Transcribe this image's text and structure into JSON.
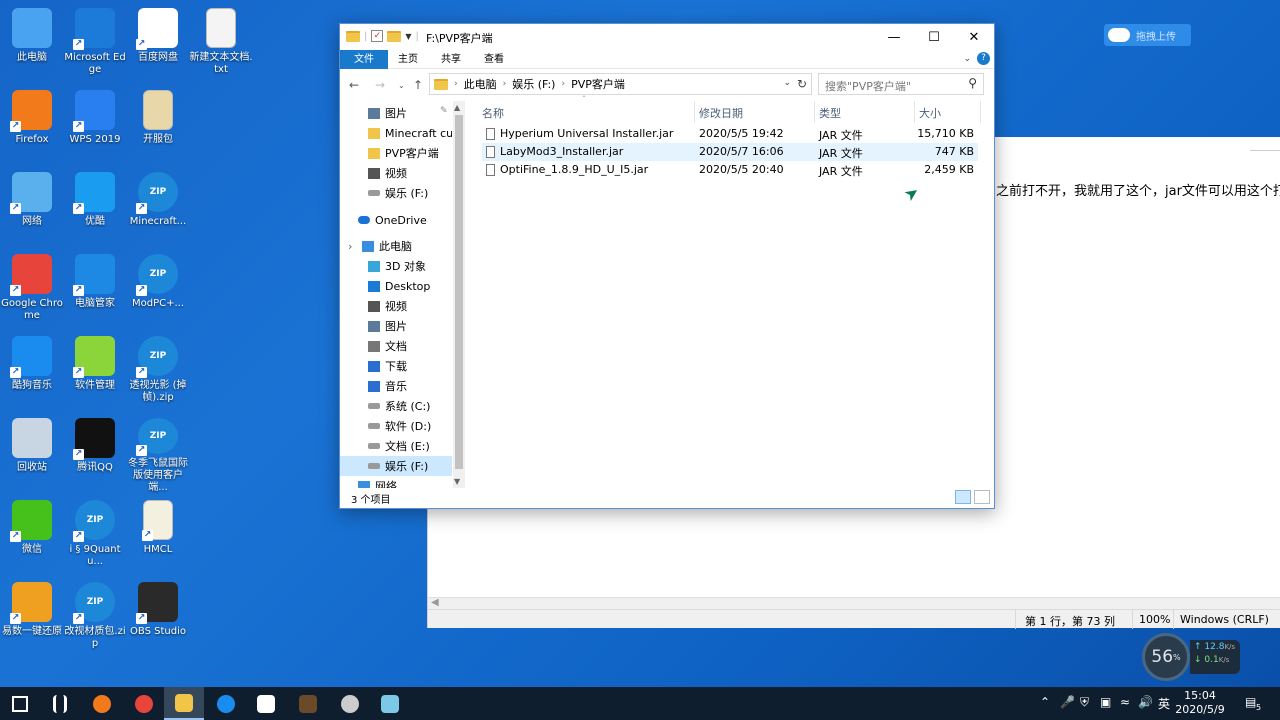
{
  "desktop": {
    "icons": [
      {
        "label": "此电脑",
        "icon": "computer-icon",
        "color": "#4aa3f0"
      },
      {
        "label": "Microsoft Edge",
        "icon": "edge-icon",
        "color": "#1c7ad8"
      },
      {
        "label": "百度网盘",
        "icon": "baidu-netdisk-icon",
        "color": "#ffffff"
      },
      {
        "label": "新建文本文档.txt",
        "icon": "text-file-icon",
        "color": "#f4f4f4"
      },
      {
        "label": "Firefox",
        "icon": "firefox-icon",
        "color": "#f27a1a"
      },
      {
        "label": "WPS 2019",
        "icon": "wps-icon",
        "color": "#2a7ff0"
      },
      {
        "label": "开服包",
        "icon": "winrar-icon",
        "color": "#e8d7a8"
      },
      {
        "label": "网络",
        "icon": "network-icon",
        "color": "#5ab0ec"
      },
      {
        "label": "优酷",
        "icon": "youku-icon",
        "color": "#1a9cf0"
      },
      {
        "label": "Minecraft...",
        "icon": "zip-icon",
        "color": "#1e88d8"
      },
      {
        "label": "Google Chrome",
        "icon": "chrome-icon",
        "color": "#e7453b"
      },
      {
        "label": "电脑管家",
        "icon": "pc-manager-icon",
        "color": "#1e88e5"
      },
      {
        "label": "ModPC+...",
        "icon": "zip-icon",
        "color": "#1e88d8"
      },
      {
        "label": "酷狗音乐",
        "icon": "kugou-icon",
        "color": "#1a8cf0"
      },
      {
        "label": "软件管理",
        "icon": "software-manager-icon",
        "color": "#8bd43a"
      },
      {
        "label": "透视光影 (掉帧).zip",
        "icon": "zip-icon",
        "color": "#1e88d8"
      },
      {
        "label": "回收站",
        "icon": "recycle-bin-icon",
        "color": "#c8d6e4"
      },
      {
        "label": "腾讯QQ",
        "icon": "qq-icon",
        "color": "#111111"
      },
      {
        "label": "冬季飞鼠国际版使用客户端...",
        "icon": "zip-icon",
        "color": "#1e88d8"
      },
      {
        "label": "微信",
        "icon": "wechat-icon",
        "color": "#46c01b"
      },
      {
        "label": "ⅰ  § 9Quantu...",
        "icon": "zip-icon",
        "color": "#1e88d8"
      },
      {
        "label": "HMCL",
        "icon": "hmcl-icon",
        "color": "#f4f0e0"
      },
      {
        "label": "易数一键还原",
        "icon": "restore-icon",
        "color": "#f0a020"
      },
      {
        "label": "改视材质包.zip",
        "icon": "zip-icon",
        "color": "#1e88d8"
      },
      {
        "label": "OBS Studio",
        "icon": "obs-icon",
        "color": "#2a2a2a"
      }
    ],
    "zip_badge": "ZIP"
  },
  "baidu_float": {
    "label": "拖拽上传"
  },
  "notepad": {
    "text": "之前打不开，我就用了这个，jar文件可以用这个打",
    "status": {
      "position": "第 1 行，第 73 列",
      "zoom": "100%",
      "encoding": "Windows (CRLF)"
    }
  },
  "explorer": {
    "title": "F:\\PVP客户端",
    "ribbon_tabs": [
      "文件",
      "主页",
      "共享",
      "查看"
    ],
    "breadcrumbs": [
      "此电脑",
      "娱乐 (F:)",
      "PVP客户端"
    ],
    "search_placeholder": "搜索\"PVP客户端\"",
    "nav_items": [
      {
        "label": "图片",
        "icon": "pictures-icon"
      },
      {
        "label": "Minecraft curseforge",
        "icon": "folder-icon"
      },
      {
        "label": "PVP客户端",
        "icon": "folder-icon"
      },
      {
        "label": "视频",
        "icon": "videos-icon"
      },
      {
        "label": "娱乐 (F:)",
        "icon": "drive-icon"
      },
      {
        "label": "OneDrive",
        "icon": "onedrive-icon"
      },
      {
        "label": "此电脑",
        "icon": "computer-icon"
      },
      {
        "label": "3D 对象",
        "icon": "3d-objects-icon"
      },
      {
        "label": "Desktop",
        "icon": "desktop-icon"
      },
      {
        "label": "视频",
        "icon": "videos-icon"
      },
      {
        "label": "图片",
        "icon": "pictures-icon"
      },
      {
        "label": "文档",
        "icon": "documents-icon"
      },
      {
        "label": "下载",
        "icon": "downloads-icon"
      },
      {
        "label": "音乐",
        "icon": "music-icon"
      },
      {
        "label": "系统 (C:)",
        "icon": "drive-icon"
      },
      {
        "label": "软件 (D:)",
        "icon": "drive-icon"
      },
      {
        "label": "文档 (E:)",
        "icon": "drive-icon"
      },
      {
        "label": "娱乐 (F:)",
        "icon": "drive-icon"
      },
      {
        "label": "网络",
        "icon": "network-icon"
      }
    ],
    "columns": [
      "名称",
      "修改日期",
      "类型",
      "大小"
    ],
    "files": [
      {
        "name": "Hyperium Universal Installer.jar",
        "date": "2020/5/5 19:42",
        "type": "JAR 文件",
        "size": "15,710 KB"
      },
      {
        "name": "LabyMod3_Installer.jar",
        "date": "2020/5/7 16:06",
        "type": "JAR 文件",
        "size": "747 KB"
      },
      {
        "name": "OptiFine_1.8.9_HD_U_I5.jar",
        "date": "2020/5/5 20:40",
        "type": "JAR 文件",
        "size": "2,459 KB"
      }
    ],
    "status": "3 个项目"
  },
  "net_widget": {
    "percent": "56",
    "unit": "%",
    "up": "12.8",
    "down": "0.1",
    "rate_unit": "K/s"
  },
  "taskbar": {
    "apps": [
      {
        "name": "start",
        "icon": "windows-icon",
        "color": "#ffffff"
      },
      {
        "name": "taskview",
        "icon": "task-view-icon",
        "color": "#ffffff"
      },
      {
        "name": "firefox",
        "icon": "firefox-icon",
        "color": "#f27a1a"
      },
      {
        "name": "chrome",
        "icon": "chrome-icon",
        "color": "#e7453b"
      },
      {
        "name": "explorer",
        "icon": "file-explorer-icon",
        "color": "#f0c54a"
      },
      {
        "name": "kugou",
        "icon": "kugou-icon",
        "color": "#1a8cf0"
      },
      {
        "name": "store",
        "icon": "store-icon",
        "color": "#ffffff"
      },
      {
        "name": "minecraft",
        "icon": "minecraft-icon",
        "color": "#6b4a2a"
      },
      {
        "name": "obs",
        "icon": "obs-icon",
        "color": "#cccccc"
      },
      {
        "name": "notepad",
        "icon": "notepad-icon",
        "color": "#7cc8e8"
      }
    ],
    "ime": "英",
    "time": "15:04",
    "date": "2020/5/9",
    "notification_count": "5"
  }
}
